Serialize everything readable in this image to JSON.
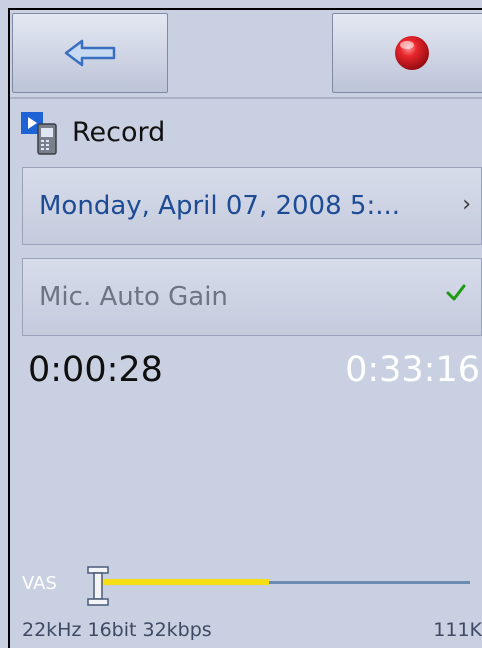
{
  "toolbar": {
    "back_icon": "back-arrow-icon",
    "record_icon": "record-dot-icon",
    "record_color": "#d8121a"
  },
  "app": {
    "title": "Record",
    "icon": "record-app-icon"
  },
  "items": {
    "date_label": "Monday, April 07, 2008 5:...",
    "date_chevron": "›",
    "gain_label": "Mic. Auto Gain",
    "gain_checked": true,
    "check_color": "#1d9a12"
  },
  "timer": {
    "elapsed": "0:00:28",
    "remaining": "0:33:16"
  },
  "vas": {
    "label": "VAS",
    "level": 0.46,
    "fill_color": "#f6de16"
  },
  "status": {
    "format": "22kHz 16bit 32kbps",
    "size": "111K"
  }
}
